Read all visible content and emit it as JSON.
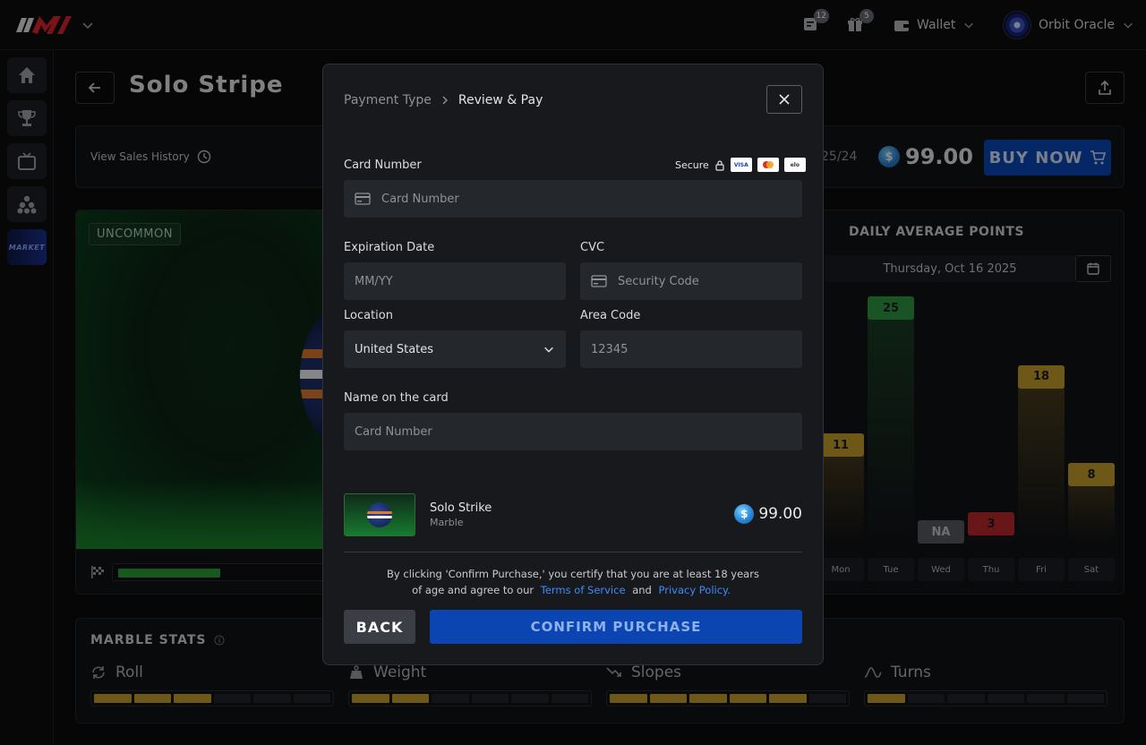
{
  "header": {
    "notifications_count": "12",
    "gifts_count": "5",
    "wallet_label": "Wallet",
    "user_name": "Orbit Oracle"
  },
  "sidebar": {
    "market_label": "MARKET"
  },
  "page": {
    "title": "Solo Stripe",
    "view_sales_history": "View Sales History",
    "date_fragment": "25/24",
    "price": "99.00",
    "buy_now": "BUY NOW",
    "rarity": "UNCOMMON",
    "progress_fraction": 0.46
  },
  "chart_data": {
    "type": "bar",
    "title": "DAILY AVERAGE POINTS",
    "date": "Thursday, Oct 16 2025",
    "categories": [
      "Mon",
      "Tue",
      "Wed",
      "Thu",
      "Fri",
      "Sat"
    ],
    "values": [
      11,
      25,
      null,
      3,
      18,
      8
    ],
    "labels": [
      "11",
      "25",
      "NA",
      "3",
      "18",
      "8"
    ],
    "colors": [
      "#c8a02c",
      "#2f9a44",
      "#5a5c62",
      "#c0282c",
      "#c8a02c",
      "#c8a02c"
    ],
    "ylim": [
      0,
      25
    ]
  },
  "stats": {
    "title": "MARBLE STATS",
    "items": [
      {
        "name": "Roll",
        "filled": 3,
        "total": 6
      },
      {
        "name": "Weight",
        "filled": 2,
        "total": 6
      },
      {
        "name": "Slopes",
        "filled": 5,
        "total": 6
      },
      {
        "name": "Turns",
        "filled": 1,
        "total": 6
      }
    ]
  },
  "modal": {
    "breadcrumb_prev": "Payment Type",
    "breadcrumb_current": "Review & Pay",
    "secure_label": "Secure",
    "card_number_label": "Card Number",
    "card_number_placeholder": "Card Number",
    "expiration_label": "Expiration Date",
    "expiration_placeholder": "MM/YY",
    "cvc_label": "CVC",
    "cvc_placeholder": "Security Code",
    "location_label": "Location",
    "location_value": "United States",
    "area_code_label": "Area Code",
    "area_code_placeholder": "12345",
    "name_label": "Name on the card",
    "name_placeholder": "Card Number",
    "item_name": "Solo Strike",
    "item_type": "Marble",
    "item_price": "99.00",
    "terms_line1": "By clicking 'Confirm Purchase,' you certify that you are at least 18 years",
    "terms_line2": "of age and agree to our",
    "terms_link": "Terms of Service",
    "terms_and": "and",
    "privacy_link": "Privacy Policy.",
    "back_label": "BACK",
    "confirm_label": "CONFIRM PURCHASE"
  }
}
